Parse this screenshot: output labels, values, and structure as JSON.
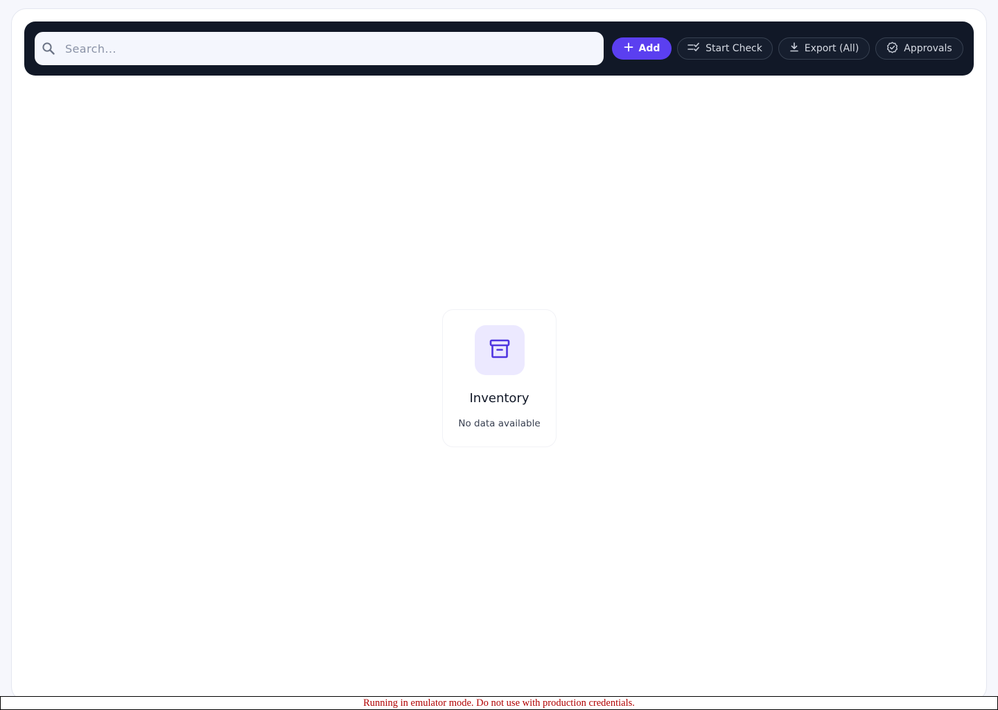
{
  "toolbar": {
    "search": {
      "placeholder": "Search...",
      "value": ""
    },
    "buttons": {
      "add": {
        "label": "Add",
        "icon": "plus-icon"
      },
      "start_check": {
        "label": "Start Check",
        "icon": "checklist-icon"
      },
      "export": {
        "label": "Export (All)",
        "icon": "download-icon"
      },
      "approvals": {
        "label": "Approvals",
        "icon": "badge-check-icon"
      }
    }
  },
  "empty_state": {
    "icon": "archive-box-icon",
    "title": "Inventory",
    "subtitle": "No data available"
  },
  "banner": {
    "text": "Running in emulator mode. Do not use with production credentials."
  },
  "colors": {
    "toolbar_bg": "#111827",
    "accent": "#5b3ff0",
    "icon_tile_bg": "#ece9ff",
    "banner_text": "#b00000"
  }
}
